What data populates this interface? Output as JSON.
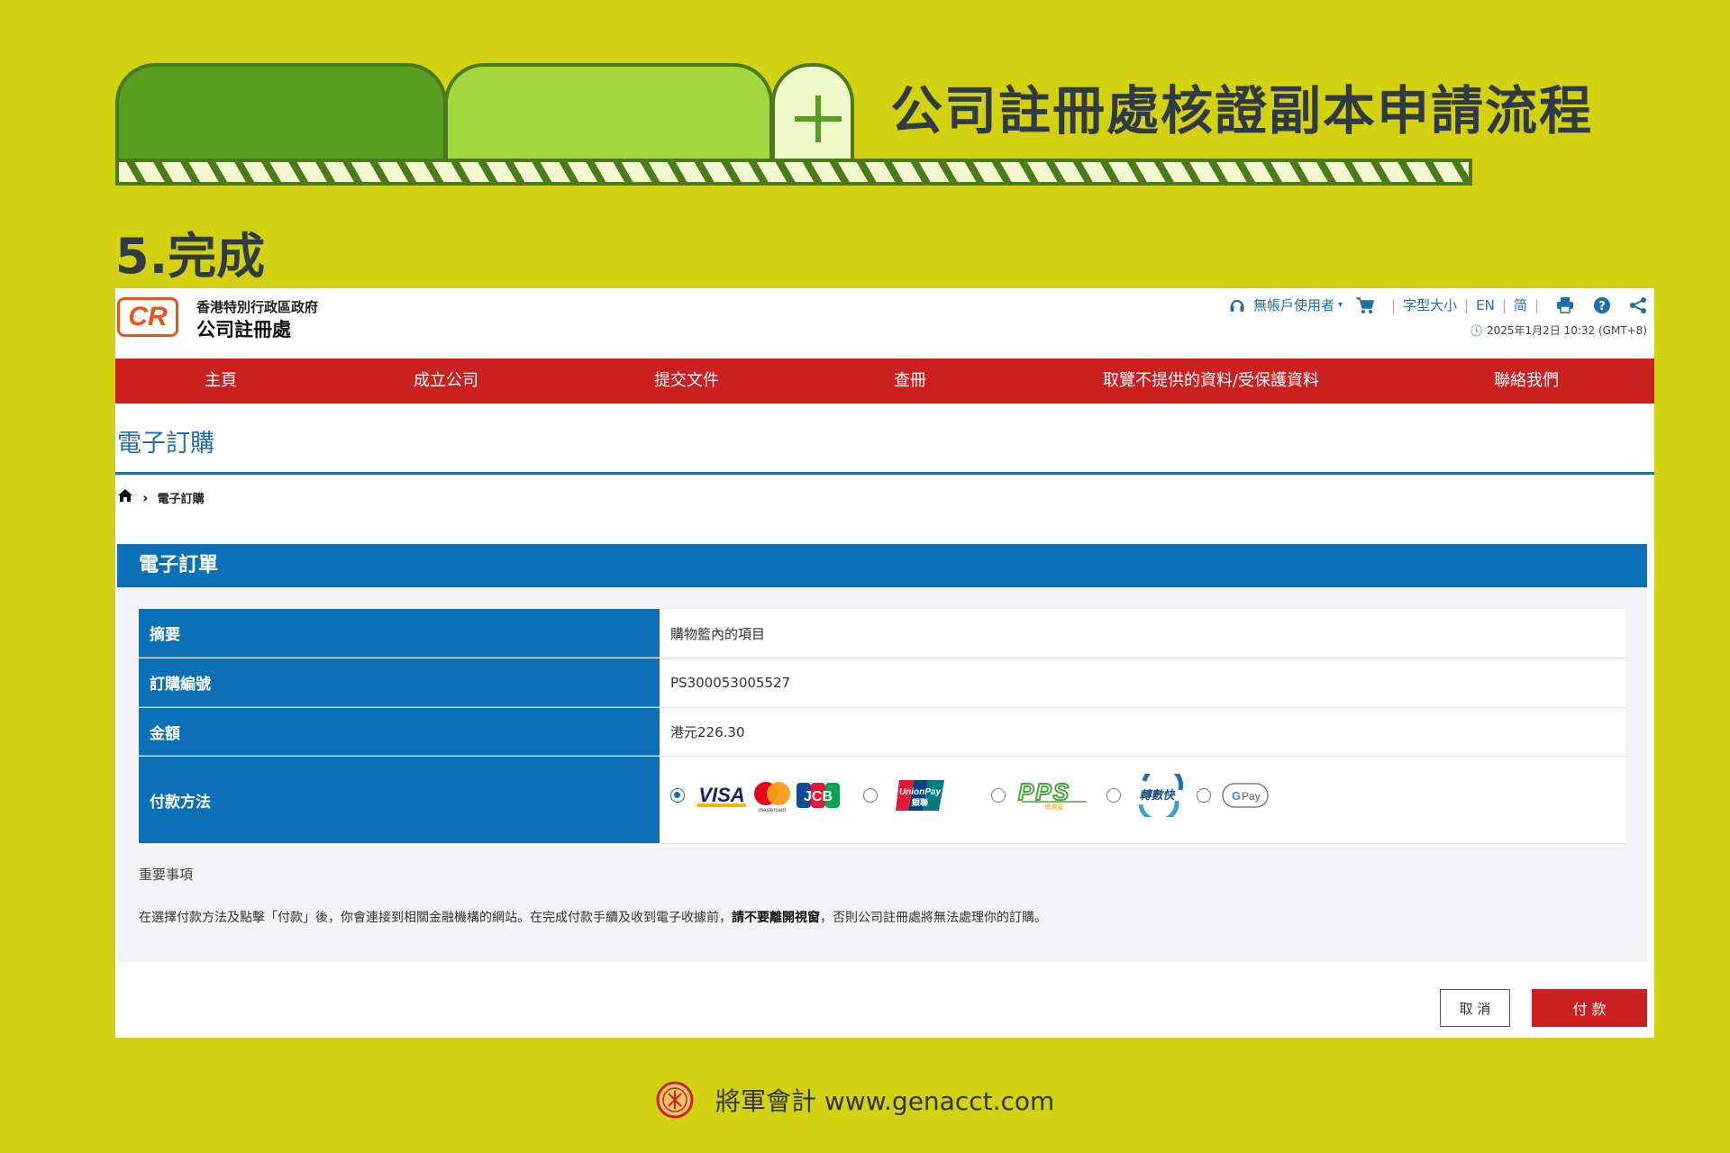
{
  "slide": {
    "title": "公司註冊處核證副本申請流程",
    "step": "5.完成",
    "footer_text": "將軍會計 www.genacct.com"
  },
  "site": {
    "logo_text": "CR",
    "gov_name": "香港特別行政區政府",
    "registry_name": "公司註冊處",
    "util": {
      "user": "無帳戶使用者",
      "font_size": "字型大小",
      "lang_en": "EN",
      "lang_sc": "简"
    },
    "datetime": "2025年1月2日 10:32 (GMT+8)",
    "nav": [
      "主頁",
      "成立公司",
      "提交文件",
      "查冊",
      "取覽不提供的資料/受保護資料",
      "聯絡我們"
    ],
    "page_heading": "電子訂購",
    "breadcrumb": "電子訂購"
  },
  "order": {
    "panel_title": "電子訂單",
    "summary_label": "摘要",
    "summary_value": "購物籃內的項目",
    "order_no_label": "訂購編號",
    "order_no_value": "PS300053005527",
    "amount_label": "金額",
    "amount_value": "港元226.30",
    "payment_label": "付款方法",
    "payment_options": [
      "VISA / Mastercard / JCB",
      "UnionPay 銀聯",
      "PPS 繳費靈",
      "轉數快",
      "G Pay"
    ],
    "selected_payment": "VISA / Mastercard / JCB",
    "important_heading": "重要事項",
    "notice_before": "在選擇付款方法及點擊「付款」後，你會連接到相關金融機構的網站。在完成付款手續及收到電子收據前，",
    "notice_bold": "請不要離開視窗",
    "notice_after": "，否則公司註冊處將無法處理你的訂購。",
    "cancel_label": "取 消",
    "pay_label": "付 款"
  },
  "colors": {
    "background": "#d2d213",
    "nav_red": "#cc1f1f",
    "panel_blue": "#0b70b6",
    "heading_blue": "#1f6fa8"
  }
}
